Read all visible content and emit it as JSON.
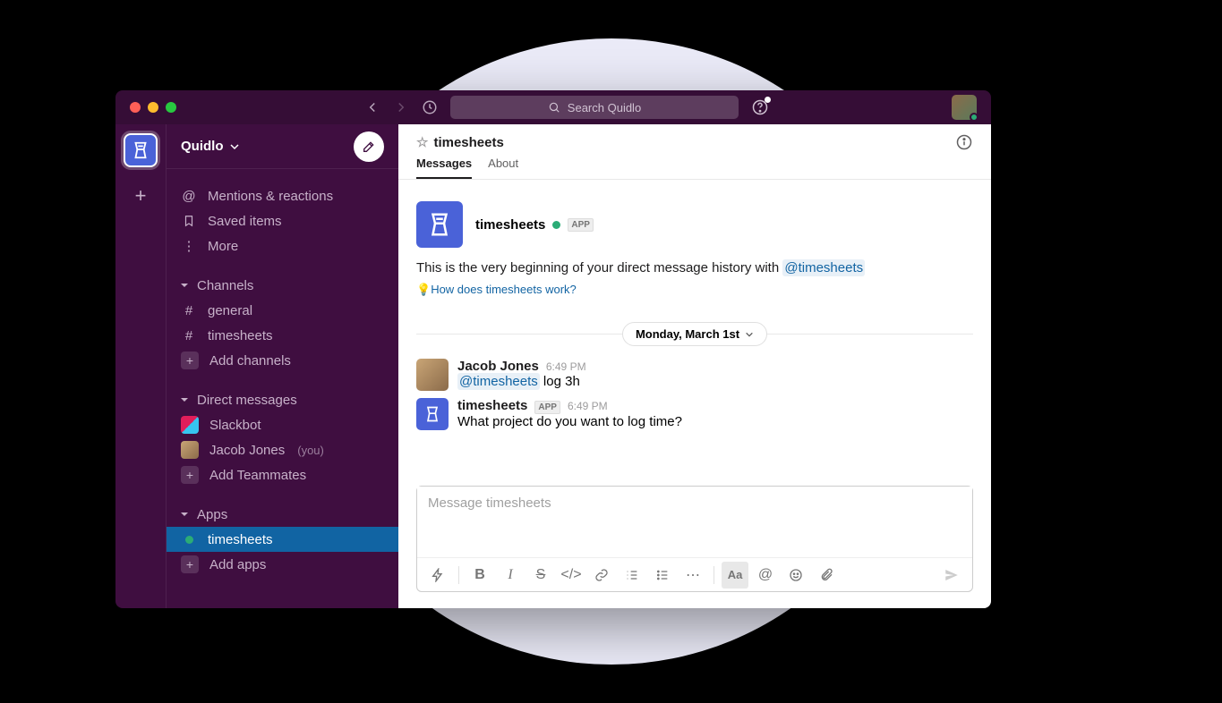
{
  "workspace": {
    "name": "Quidlo"
  },
  "titlebar": {
    "search_placeholder": "Search Quidlo"
  },
  "sidebar": {
    "top": {
      "mentions": "Mentions & reactions",
      "saved": "Saved items",
      "more": "More"
    },
    "channels": {
      "header": "Channels",
      "items": [
        "general",
        "timesheets"
      ],
      "add": "Add channels"
    },
    "dms": {
      "header": "Direct messages",
      "slackbot": "Slackbot",
      "jacob": "Jacob Jones",
      "you_label": "(you)",
      "add": "Add Teammates"
    },
    "apps": {
      "header": "Apps",
      "items": [
        "timesheets"
      ],
      "add": "Add apps"
    }
  },
  "channel": {
    "name": "timesheets",
    "tabs": {
      "messages": "Messages",
      "about": "About"
    },
    "app_intro": {
      "app_name": "timesheets",
      "badge": "APP",
      "text_prefix": "This is the very beginning of your direct message history with ",
      "mention": "@timesheets",
      "help_link": "How does timesheets work?"
    },
    "date_divider": "Monday, March 1st",
    "messages": [
      {
        "author": "Jacob Jones",
        "time": "6:49 PM",
        "mention": "@timesheets",
        "text_after": " log 3h"
      },
      {
        "author": "timesheets",
        "is_app": true,
        "badge": "APP",
        "time": "6:49 PM",
        "text": "What project do you want to log time?"
      }
    ],
    "composer": {
      "placeholder": "Message timesheets"
    }
  }
}
